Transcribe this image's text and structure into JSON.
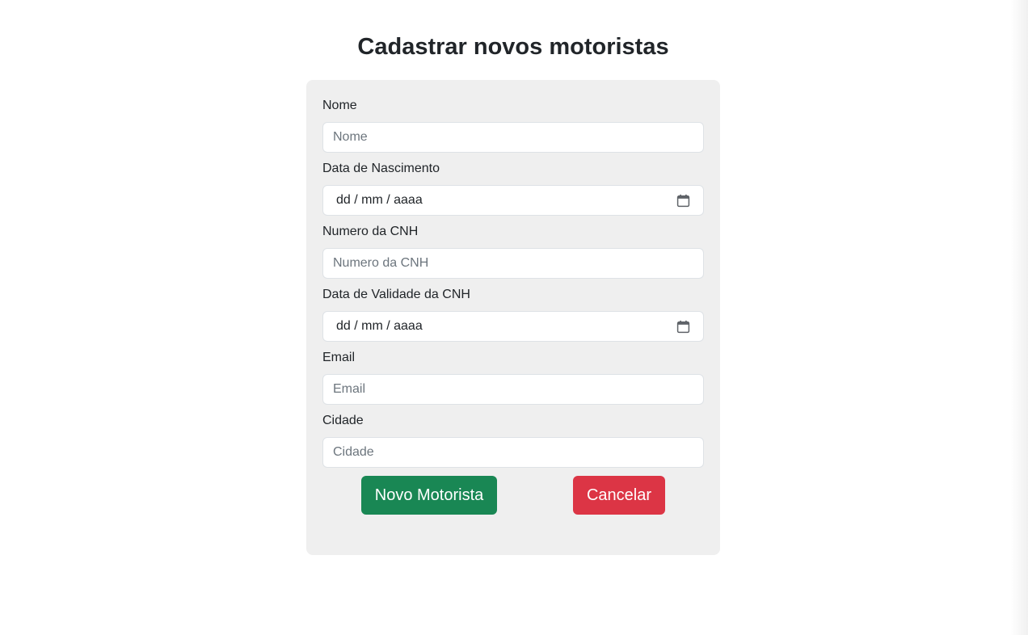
{
  "page": {
    "title": "Cadastrar novos motoristas"
  },
  "form": {
    "fields": [
      {
        "label": "Nome",
        "type": "text",
        "placeholder": "Nome",
        "value": ""
      },
      {
        "label": "Data de Nascimento",
        "type": "date",
        "display": "dd / mm / aaaa"
      },
      {
        "label": "Numero da CNH",
        "type": "text",
        "placeholder": "Numero da CNH",
        "value": ""
      },
      {
        "label": "Data de Validade da CNH",
        "type": "date",
        "display": "dd / mm / aaaa"
      },
      {
        "label": "Email",
        "type": "text",
        "placeholder": "Email",
        "value": ""
      },
      {
        "label": "Cidade",
        "type": "text",
        "placeholder": "Cidade",
        "value": ""
      }
    ],
    "icons": {
      "date": "calendar-icon"
    }
  },
  "buttons": {
    "submit_label": "Novo Motorista",
    "cancel_label": "Cancelar"
  },
  "colors": {
    "success": "#198754",
    "danger": "#dc3545",
    "card_background": "#efefef"
  }
}
